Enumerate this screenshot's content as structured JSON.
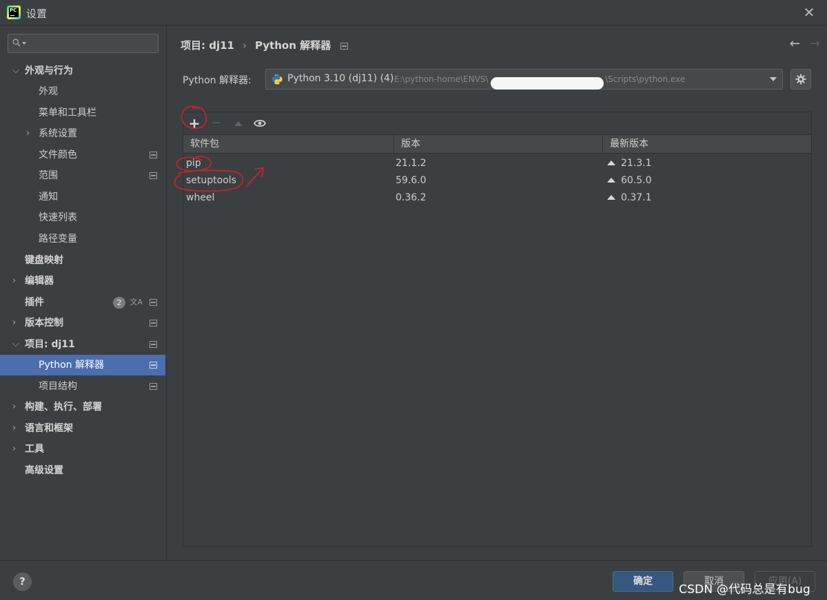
{
  "window": {
    "title": "设置",
    "close_glyph": "✕"
  },
  "search": {
    "placeholder": "",
    "value": ""
  },
  "sidebar": {
    "items": [
      {
        "label": "外观与行为",
        "bold": true,
        "expanded": true,
        "indent": 0
      },
      {
        "label": "外观",
        "indent": 1
      },
      {
        "label": "菜单和工具栏",
        "indent": 1
      },
      {
        "label": "系统设置",
        "indent": 1,
        "expandable": true
      },
      {
        "label": "文件颜色",
        "indent": 1,
        "project_icon": true
      },
      {
        "label": "范围",
        "indent": 1,
        "project_icon": true
      },
      {
        "label": "通知",
        "indent": 1
      },
      {
        "label": "快速列表",
        "indent": 1
      },
      {
        "label": "路径变量",
        "indent": 1
      },
      {
        "label": "键盘映射",
        "bold": true,
        "indent": 0
      },
      {
        "label": "编辑器",
        "bold": true,
        "indent": 0,
        "expandable": true
      },
      {
        "label": "插件",
        "bold": true,
        "indent": 0,
        "badge": "2",
        "translate_icon": true,
        "project_icon": true
      },
      {
        "label": "版本控制",
        "bold": true,
        "indent": 0,
        "expandable": true,
        "project_icon": true
      },
      {
        "label": "项目: dj11",
        "bold": true,
        "indent": 0,
        "expanded": true,
        "project_icon": true
      },
      {
        "label": "Python 解释器",
        "indent": 1,
        "selected": true,
        "project_icon": true
      },
      {
        "label": "项目结构",
        "indent": 1,
        "project_icon": true
      },
      {
        "label": "构建、执行、部署",
        "bold": true,
        "indent": 0,
        "expandable": true
      },
      {
        "label": "语言和框架",
        "bold": true,
        "indent": 0,
        "expandable": true
      },
      {
        "label": "工具",
        "bold": true,
        "indent": 0,
        "expandable": true
      },
      {
        "label": "高级设置",
        "bold": true,
        "indent": 0
      }
    ]
  },
  "breadcrumb": {
    "project": "项目: dj11",
    "page": "Python 解释器"
  },
  "interpreter": {
    "label": "Python 解释器:",
    "name": "Python 3.10 (dj11) (4)",
    "path_start": "E:\\python-home\\ENVS\\",
    "path_end": "\\Scripts\\python.exe"
  },
  "table": {
    "headers": {
      "package": "软件包",
      "version": "版本",
      "latest": "最新版本"
    },
    "rows": [
      {
        "package": "pip",
        "version": "21.1.2",
        "latest": "21.3.1"
      },
      {
        "package": "setuptools",
        "version": "59.6.0",
        "latest": "60.5.0"
      },
      {
        "package": "wheel",
        "version": "0.36.2",
        "latest": "0.37.1"
      }
    ]
  },
  "toolbar": {
    "add": "+",
    "remove": "−"
  },
  "nav": {
    "back": "←",
    "forward": "→"
  },
  "footer": {
    "help": "?",
    "ok": "确定",
    "cancel": "取消",
    "apply": "应用(A)",
    "watermark": "CSDN @代码总是有bug"
  },
  "colors": {
    "background": "#3c3f41",
    "selection": "#4b6eaf",
    "ok_button": "#365880",
    "annotation": "#c0262d"
  }
}
